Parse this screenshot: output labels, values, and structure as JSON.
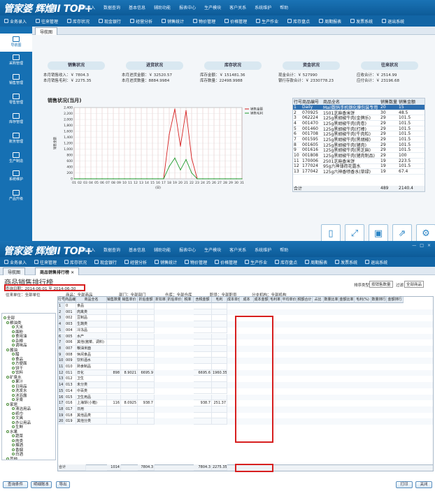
{
  "app": {
    "logo": "管家婆 辉煌II TOP+",
    "menu": [
      "业务录入",
      "数据查询",
      "基本信息",
      "辅助功能",
      "报表中心",
      "生产模块",
      "客户关系",
      "系统维护",
      "帮助"
    ],
    "toolbar": [
      "业务录入",
      "往来管理",
      "库存状况",
      "现金银行",
      "经营分析",
      "销售统计",
      "物价管理",
      "价格管理",
      "生产作业",
      "库存盘点",
      "周期报表",
      "发票系统",
      "退出系统"
    ]
  },
  "top": {
    "sidebar": [
      "导航图",
      "采购管理",
      "销售管理",
      "零售管理",
      "库存管理",
      "账务管理",
      "生产制造",
      "系统维护",
      "产品升级"
    ],
    "tab": "导航图",
    "cards": [
      {
        "title": "销售状况",
        "line1": "本月销售收入：￥ 7804.3",
        "line2": "本月销售毛利：￥ 2275.35"
      },
      {
        "title": "进货状况",
        "line1": "本月进货金额：￥ 32520.57",
        "line2": "本月进货数量：8884.9984"
      },
      {
        "title": "库存状况",
        "line1": "库存金额：￥ 151481.36",
        "line2": "库存数量：22498.9988"
      },
      {
        "title": "资金状况",
        "line1": "现金合计：￥ 527990",
        "line2": "银行存款合计：￥ 2330778.23"
      },
      {
        "title": "往来状况",
        "line1": "应收合计：￥ 2514.99",
        "line2": "应付合计：￥ 23196.68"
      }
    ],
    "grid": {
      "headers": [
        "行号",
        "商品编号",
        "商品全名",
        "销售数量",
        "销售金额"
      ],
      "rows": [
        [
          "1",
          "Daily",
          "Mail数码手机钢化膜包装专用",
          "20",
          "15"
        ],
        [
          "2",
          "070925",
          "1501芝麻香米饼",
          "30",
          "48.5"
        ],
        [
          "3",
          "062224",
          "125g黑胡椒牛肉(金牌乐)",
          "29",
          "101.5"
        ],
        [
          "4",
          "001470",
          "125g黑胡椒牛肉(肉卷)",
          "29",
          "101.5"
        ],
        [
          "5",
          "001460",
          "125g黑胡椒牛肉(打棒)",
          "29",
          "101.5"
        ],
        [
          "6",
          "001708",
          "125g黑胡椒牛肉(牛肉粒)",
          "29",
          "101.5"
        ],
        [
          "7",
          "001595",
          "125g黑胡椒牛肉(黑胡椒)",
          "29",
          "101.5"
        ],
        [
          "8",
          "001605",
          "125g黑胡椒牛肉(猪肉)",
          "29",
          "101.5"
        ],
        [
          "9",
          "001616",
          "125g黑胡椒牛肉(黑芝麻)",
          "29",
          "101.5"
        ],
        [
          "10",
          "001808",
          "125g黑胡椒牛肉(猪肉制品)",
          "29",
          "100"
        ],
        [
          "11",
          "170006",
          "2501芝麻香米饼",
          "19",
          "223.5"
        ],
        [
          "12",
          "177024",
          "95g六神薄荷花露水",
          "19",
          "101.5"
        ],
        [
          "13",
          "177042",
          "125g六神香喷香水(草绿)",
          "19",
          "67.4"
        ]
      ],
      "total_label": "合计",
      "total_qty": "489",
      "total_amt": "2140.4"
    },
    "icons": [
      "tablet-icon",
      "expand-icon",
      "save-icon",
      "export-icon",
      "settings-icon"
    ]
  },
  "chart_data": {
    "type": "line",
    "title": "销售状况(当月)",
    "xlabel": "(日)",
    "ylabel": "销售金额",
    "ylim": [
      0,
      2400
    ],
    "yticks": [
      "2,400",
      "2,200",
      "2,000",
      "1,800",
      "1,600",
      "1,400",
      "1,200",
      "1,000",
      "800",
      "600",
      "400",
      "200",
      "0"
    ],
    "x": [
      "01",
      "02",
      "03",
      "04",
      "05",
      "06",
      "07",
      "08",
      "09",
      "10",
      "11",
      "12",
      "13",
      "14",
      "15",
      "16",
      "17",
      "18",
      "19",
      "20",
      "21",
      "22",
      "23",
      "24",
      "25",
      "26",
      "27",
      "28",
      "29",
      "30",
      "31"
    ],
    "series": [
      {
        "name": "销售金额",
        "color": "#d62020",
        "values": [
          0,
          0,
          0,
          0,
          0,
          0,
          0,
          0,
          0,
          0,
          0,
          0,
          0,
          0,
          0,
          0,
          0,
          1500,
          2350,
          1100,
          2300,
          700,
          0,
          0,
          0,
          0,
          0,
          0,
          0,
          0,
          0
        ]
      },
      {
        "name": "销售毛利",
        "color": "#1f9a2c",
        "values": [
          0,
          0,
          0,
          0,
          0,
          0,
          0,
          0,
          0,
          0,
          0,
          0,
          0,
          0,
          0,
          0,
          0,
          420,
          700,
          300,
          650,
          200,
          0,
          0,
          0,
          0,
          0,
          0,
          0,
          0,
          0
        ]
      }
    ],
    "legend": "top-right"
  },
  "bottom": {
    "logo": "管家婆 辉煌II TOP+",
    "win": [
      "—",
      "□",
      "×"
    ],
    "tabs": [
      "导航图",
      "商品销售排行榜"
    ],
    "page_title": "商品销售排行榜",
    "date_label": "查询日期：2014-06-01 至 2014-06-30",
    "filter1": "往来单位：全部单位",
    "filter2": "商品：全部商品",
    "filter3": "部门：全部部门",
    "filter4": "仓库：全部仓库",
    "filter5": "职员：全部职员",
    "filter6": "分支机构：全部机构",
    "right_labels": [
      "排序类型",
      "按销售数量",
      "过滤",
      "全部商品"
    ],
    "tree": [
      "全部",
      "粮油类",
      "大米",
      "面粉",
      "食用油",
      "杂粮",
      "调味品",
      "酱油",
      "醋",
      "食品",
      "方便面",
      "饼干",
      "饮料",
      "矿泉水",
      "果汁",
      "日用品",
      "洗发水",
      "沐浴露",
      "牙膏",
      "家居",
      "清洁用品",
      "纸巾",
      "文具",
      "办公用品",
      "生鲜",
      "水果",
      "蔬菜",
      "肉类",
      "烟酒",
      "香烟",
      "白酒",
      "其他"
    ],
    "headers": [
      "行号",
      "商品编号",
      "商品全名",
      "销售数量",
      "销售单价",
      "折后金额",
      "折扣率",
      "折后单价",
      "税率",
      "含税金额",
      "毛利",
      "成本单价",
      "成本",
      "成本金额",
      "毛利率",
      "平均单价",
      "税额合计",
      "占比",
      "数量比率",
      "金额比率",
      "毛利(%)",
      "数量排行",
      "金额排行"
    ],
    "rows": [
      {
        "no": "1",
        "code": "0",
        "name": "食品",
        "qty": "",
        "c1": "",
        "c2": "",
        "amt": "",
        "gp": ""
      },
      {
        "no": "2",
        "code": "001",
        "name": "肉禽类",
        "qty": "",
        "c1": "",
        "c2": "",
        "amt": "",
        "gp": ""
      },
      {
        "no": "3",
        "code": "002",
        "name": "豆制品",
        "qty": "",
        "c1": "",
        "c2": "",
        "amt": "",
        "gp": ""
      },
      {
        "no": "4",
        "code": "003",
        "name": "生蔬类",
        "qty": "",
        "c1": "",
        "c2": "",
        "amt": "",
        "gp": ""
      },
      {
        "no": "5",
        "code": "004",
        "name": "冷冻品",
        "qty": "",
        "c1": "",
        "c2": "",
        "amt": "",
        "gp": ""
      },
      {
        "no": "6",
        "code": "005",
        "name": "水产",
        "qty": "",
        "c1": "",
        "c2": "",
        "amt": "",
        "gp": ""
      },
      {
        "no": "7",
        "code": "006",
        "name": "其他(酱菜、调料)",
        "qty": "",
        "c1": "",
        "c2": "",
        "amt": "",
        "gp": ""
      },
      {
        "no": "8",
        "code": "007",
        "name": "粮油米面",
        "qty": "",
        "c1": "",
        "c2": "",
        "amt": "",
        "gp": ""
      },
      {
        "no": "9",
        "code": "008",
        "name": "休闲食品",
        "qty": "",
        "c1": "",
        "c2": "",
        "amt": "",
        "gp": ""
      },
      {
        "no": "10",
        "code": "009",
        "name": "饮料酒水",
        "qty": "",
        "c1": "",
        "c2": "",
        "amt": "",
        "gp": ""
      },
      {
        "no": "11",
        "code": "010",
        "name": "熟食制品",
        "qty": "",
        "c1": "",
        "c2": "",
        "amt": "",
        "gp": ""
      },
      {
        "no": "12",
        "code": "011",
        "name": "日化",
        "qty": "898",
        "c1": "8.9021",
        "c2": "6695.9",
        "amt": "6695.6",
        "gp": "1960.35"
      },
      {
        "no": "13",
        "code": "012",
        "name": "卫生",
        "qty": "",
        "c1": "",
        "c2": "",
        "amt": "",
        "gp": ""
      },
      {
        "no": "14",
        "code": "013",
        "name": "未分类",
        "qty": "",
        "c1": "",
        "c2": "",
        "amt": "",
        "gp": ""
      },
      {
        "no": "15",
        "code": "014",
        "name": "中百类",
        "qty": "",
        "c1": "",
        "c2": "",
        "amt": "",
        "gp": ""
      },
      {
        "no": "16",
        "code": "015",
        "name": "卫生用品",
        "qty": "",
        "c1": "",
        "c2": "",
        "amt": "",
        "gp": ""
      },
      {
        "no": "17",
        "code": "016",
        "name": "上海饼(小箱)",
        "qty": "116",
        "c1": "8.0925",
        "c2": "938.7",
        "amt": "938.7",
        "gp": "251.37"
      },
      {
        "no": "18",
        "code": "017",
        "name": "日用",
        "qty": "",
        "c1": "",
        "c2": "",
        "amt": "",
        "gp": ""
      },
      {
        "no": "19",
        "code": "018",
        "name": "其他品类",
        "qty": "",
        "c1": "",
        "c2": "",
        "amt": "",
        "gp": ""
      },
      {
        "no": "20",
        "code": "019",
        "name": "其他分类",
        "qty": "",
        "c1": "",
        "c2": "",
        "amt": "",
        "gp": ""
      }
    ],
    "total": {
      "label": "合计",
      "qty": "1014",
      "c2": "7804.3",
      "amt": "7804.3",
      "gp": "2275.35"
    },
    "buttons": [
      "查询条件",
      "明细账本",
      "导出",
      "打印",
      "关闭"
    ]
  }
}
